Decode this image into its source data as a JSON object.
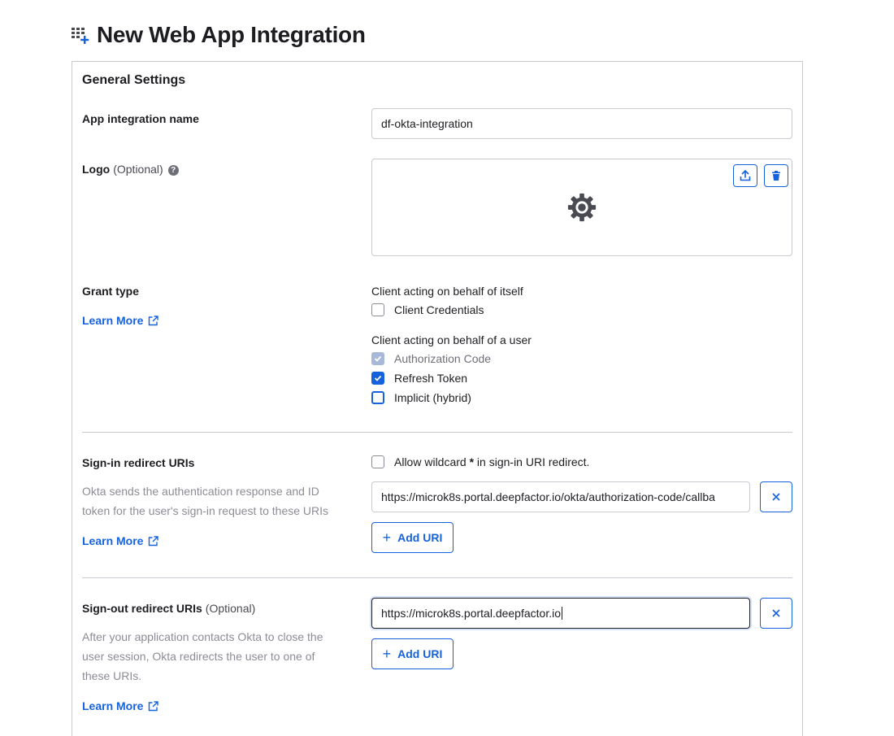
{
  "header": {
    "title": "New Web App Integration",
    "icon": "grid-plus-icon"
  },
  "general": {
    "section_title": "General Settings",
    "app_name": {
      "label": "App integration name",
      "value": "df-okta-integration"
    },
    "logo": {
      "label": "Logo",
      "optional": "(Optional)",
      "help": "?"
    },
    "grant_type": {
      "label": "Grant type",
      "learn_more": "Learn More",
      "group1_label": "Client acting on behalf of itself",
      "client_credentials": "Client Credentials",
      "group2_label": "Client acting on behalf of a user",
      "authorization_code": "Authorization Code",
      "refresh_token": "Refresh Token",
      "implicit": "Implicit (hybrid)"
    },
    "sign_in": {
      "label": "Sign-in redirect URIs",
      "description": "Okta sends the authentication response and ID token for the user's sign-in request to these URIs",
      "learn_more": "Learn More",
      "wildcard_pre": "Allow wildcard ",
      "wildcard_star": "*",
      "wildcard_post": " in sign-in URI redirect.",
      "uri_value": "https://microk8s.portal.deepfactor.io/okta/authorization-code/callba",
      "add_label": "Add URI"
    },
    "sign_out": {
      "label": "Sign-out redirect URIs",
      "optional": "(Optional)",
      "description": "After your application contacts Okta to close the user session, Okta redirects the user to one of these URIs.",
      "learn_more": "Learn More",
      "uri_value": "https://microk8s.portal.deepfactor.io",
      "add_label": "Add URI"
    }
  },
  "colors": {
    "accent": "#1662dd",
    "border": "#c9c9cf",
    "muted": "#8c8c96"
  }
}
